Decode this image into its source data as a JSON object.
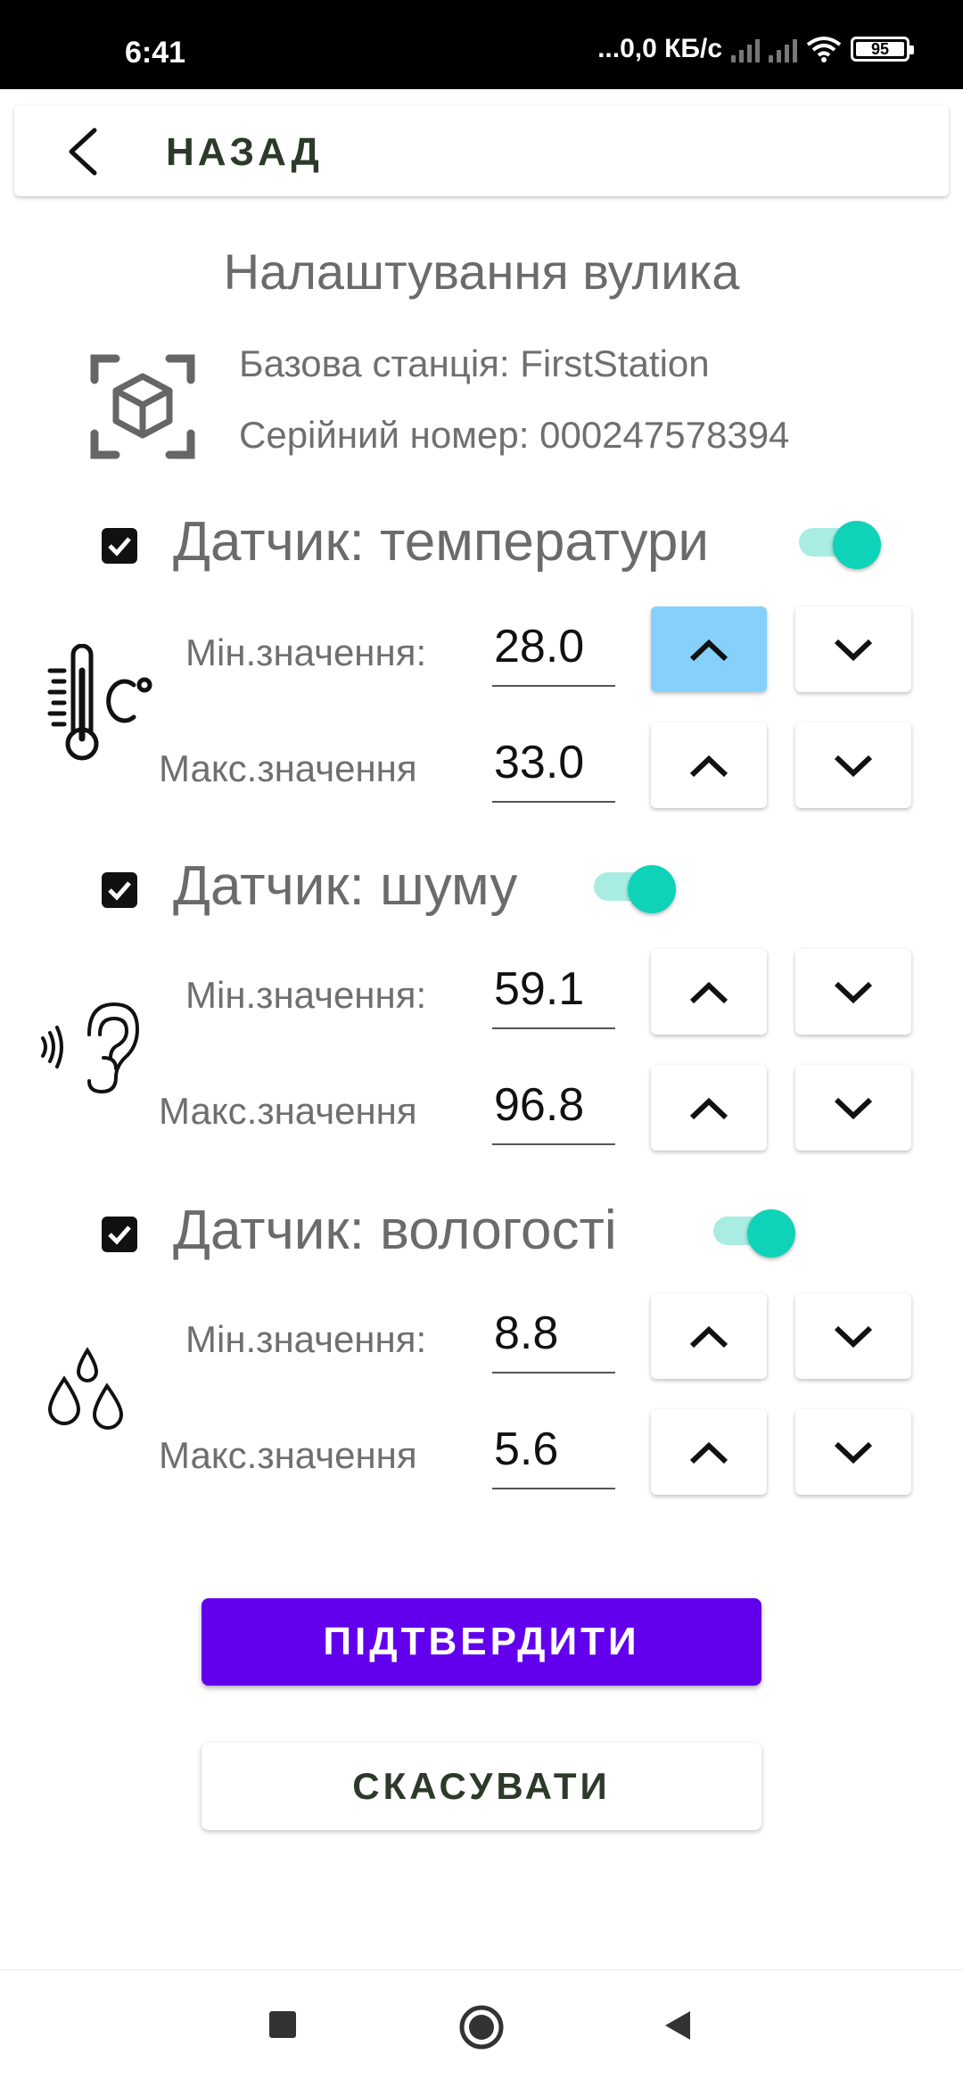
{
  "status_bar": {
    "time": "6:41",
    "network": "...0,0 КБ/с",
    "battery": "95"
  },
  "header": {
    "back_label": "НАЗАД"
  },
  "page": {
    "title": "Налаштування вулика",
    "base_station": "Базова станція: FirstStation",
    "serial": "Серійний номер: 000247578394"
  },
  "sensors": [
    {
      "title": "Датчик: температури",
      "enabled": true,
      "checked": true,
      "min_label": "Мін.значення:",
      "min_value": "28.0",
      "max_label": "Макс.значення",
      "max_value": "33.0",
      "icon": "thermometer-celsius-icon"
    },
    {
      "title": "Датчик: шуму",
      "enabled": true,
      "checked": true,
      "min_label": "Мін.значення:",
      "min_value": "59.1",
      "max_label": "Макс.значення",
      "max_value": "96.8",
      "icon": "ear-sound-icon"
    },
    {
      "title": "Датчик: вологості",
      "enabled": true,
      "checked": true,
      "min_label": "Мін.значення:",
      "min_value": "8.8",
      "max_label": "Макс.значення",
      "max_value": "5.6",
      "icon": "water-drops-icon"
    }
  ],
  "actions": {
    "confirm": "ПІДТВЕРДИТИ",
    "cancel": "СКАСУВАТИ"
  },
  "colors": {
    "accent": "#6200ee",
    "toggle": "#0fd3b8",
    "pressed": "#86d1fb"
  }
}
